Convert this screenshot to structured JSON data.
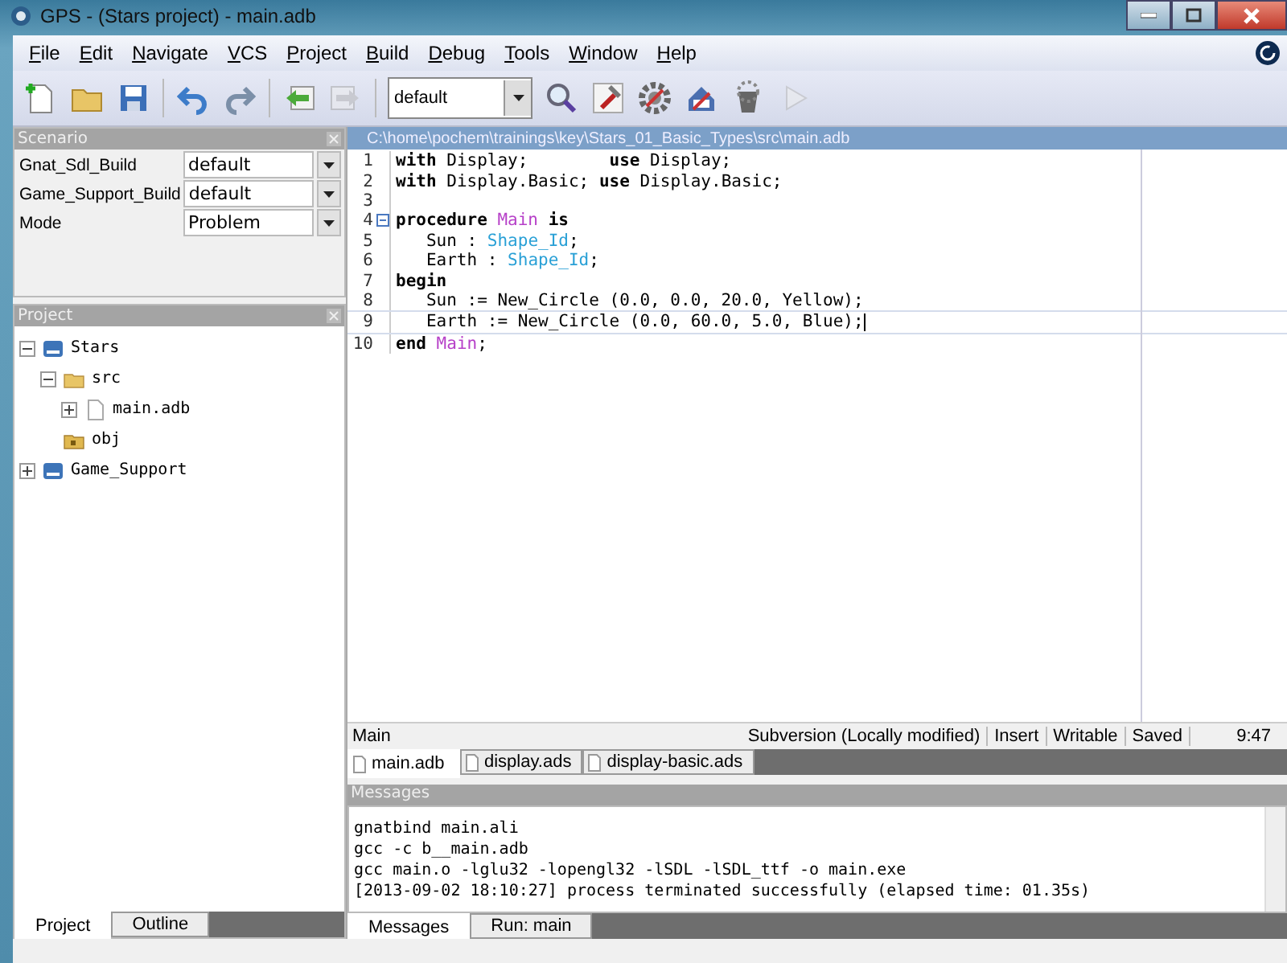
{
  "window": {
    "title": "GPS - (Stars project) - main.adb"
  },
  "menu": [
    {
      "label": "File"
    },
    {
      "label": "Edit"
    },
    {
      "label": "Navigate"
    },
    {
      "label": "VCS"
    },
    {
      "label": "Project"
    },
    {
      "label": "Build"
    },
    {
      "label": "Debug"
    },
    {
      "label": "Tools"
    },
    {
      "label": "Window"
    },
    {
      "label": "Help"
    }
  ],
  "toolbar": {
    "buttons": [
      {
        "kind": "new",
        "disabled": false
      },
      {
        "kind": "open",
        "disabled": false
      },
      {
        "kind": "save",
        "disabled": false
      },
      {
        "kind": "sep"
      },
      {
        "kind": "undo",
        "disabled": false
      },
      {
        "kind": "redo",
        "disabled": false
      },
      {
        "kind": "sep"
      },
      {
        "kind": "back",
        "disabled": false
      },
      {
        "kind": "forward",
        "disabled": true
      },
      {
        "kind": "sep"
      },
      {
        "kind": "target"
      },
      {
        "kind": "search",
        "disabled": false
      },
      {
        "kind": "hammer",
        "disabled": false
      },
      {
        "kind": "gear",
        "disabled": false
      },
      {
        "kind": "buildall",
        "disabled": false
      },
      {
        "kind": "clean",
        "disabled": false
      },
      {
        "kind": "run",
        "disabled": true
      }
    ],
    "build_target": "default"
  },
  "scenario": {
    "title": "Scenario",
    "rows": [
      {
        "label": "Gnat_Sdl_Build",
        "value": "default"
      },
      {
        "label": "Game_Support_Build",
        "value": "default"
      },
      {
        "label": "Mode",
        "value": "Problem"
      }
    ]
  },
  "project": {
    "title": "Project",
    "tree": [
      {
        "label": "Stars",
        "kind": "project",
        "expanded": true,
        "children": [
          {
            "label": "src",
            "kind": "folder",
            "expanded": true,
            "children": [
              {
                "label": "main.adb",
                "kind": "file",
                "expanded": false
              }
            ]
          },
          {
            "label": "obj",
            "kind": "objfolder"
          }
        ]
      },
      {
        "label": "Game_Support",
        "kind": "project",
        "expanded": false
      }
    ]
  },
  "left_tabs": [
    {
      "label": "Project",
      "selected": true
    },
    {
      "label": "Outline",
      "selected": false
    }
  ],
  "editor": {
    "path": "C:\\home\\pochem\\trainings\\key\\Stars_01_Basic_Types\\src\\main.adb",
    "lines": [
      {
        "number": "1",
        "current": false,
        "segments": [
          {
            "text": "with",
            "kind": "keyword"
          },
          {
            "text": " Display;        ",
            "kind": "plain"
          },
          {
            "text": "use",
            "kind": "keyword"
          },
          {
            "text": " Display;",
            "kind": "plain"
          }
        ]
      },
      {
        "number": "2",
        "current": false,
        "segments": [
          {
            "text": "with",
            "kind": "keyword"
          },
          {
            "text": " Display.Basic; ",
            "kind": "plain"
          },
          {
            "text": "use",
            "kind": "keyword"
          },
          {
            "text": " Display.Basic;",
            "kind": "plain"
          }
        ]
      },
      {
        "number": "3",
        "current": false
      },
      {
        "number": "4",
        "current": false,
        "fold": true,
        "segments": [
          {
            "text": "procedure ",
            "kind": "keyword"
          },
          {
            "text": "Main",
            "kind": "name"
          },
          {
            "text": " is",
            "kind": "keyword"
          }
        ]
      },
      {
        "number": "5",
        "current": false,
        "segments": [
          {
            "text": "   Sun : ",
            "kind": "plain"
          },
          {
            "text": "Shape_Id",
            "kind": "type"
          },
          {
            "text": ";",
            "kind": "plain"
          }
        ]
      },
      {
        "number": "6",
        "current": false,
        "segments": [
          {
            "text": "   Earth : ",
            "kind": "plain"
          },
          {
            "text": "Shape_Id",
            "kind": "type"
          },
          {
            "text": ";",
            "kind": "plain"
          }
        ]
      },
      {
        "number": "7",
        "current": false,
        "segments": [
          {
            "text": "begin",
            "kind": "keyword"
          }
        ]
      },
      {
        "number": "8",
        "current": false,
        "segments": [
          {
            "text": "   Sun := New_Circle (0.0, 0.0, 20.0, Yellow);",
            "kind": "plain"
          }
        ]
      },
      {
        "number": "9",
        "current": true,
        "segments": [
          {
            "text": "   Earth := New_Circle (0.0, 60.0, 5.0, Blue);",
            "kind": "plain"
          }
        ]
      },
      {
        "number": "10",
        "current": false,
        "segments": [
          {
            "text": "end ",
            "kind": "keyword"
          },
          {
            "text": "Main",
            "kind": "name"
          },
          {
            "text": ";",
            "kind": "plain"
          }
        ]
      }
    ]
  },
  "status_bar": {
    "context": "Main",
    "vcs": "Subversion (Locally modified)",
    "mode": "Insert",
    "access": "Writable",
    "saved": "Saved",
    "position": "9:47"
  },
  "editor_tabs": [
    {
      "label": "main.adb",
      "selected": true
    },
    {
      "label": "display.ads",
      "selected": false
    },
    {
      "label": "display-basic.ads",
      "selected": false
    }
  ],
  "messages": {
    "title": "Messages",
    "lines": [
      "gnatbind main.ali",
      "gcc -c b__main.adb",
      "gcc main.o -lglu32 -lopengl32 -lSDL -lSDL_ttf -o main.exe",
      "[2013-09-02 18:10:27] process terminated successfully (elapsed time: 01.35s)"
    ]
  },
  "bottom_tabs": [
    {
      "label": "Messages",
      "selected": true
    },
    {
      "label": "Run: main",
      "selected": false
    }
  ]
}
